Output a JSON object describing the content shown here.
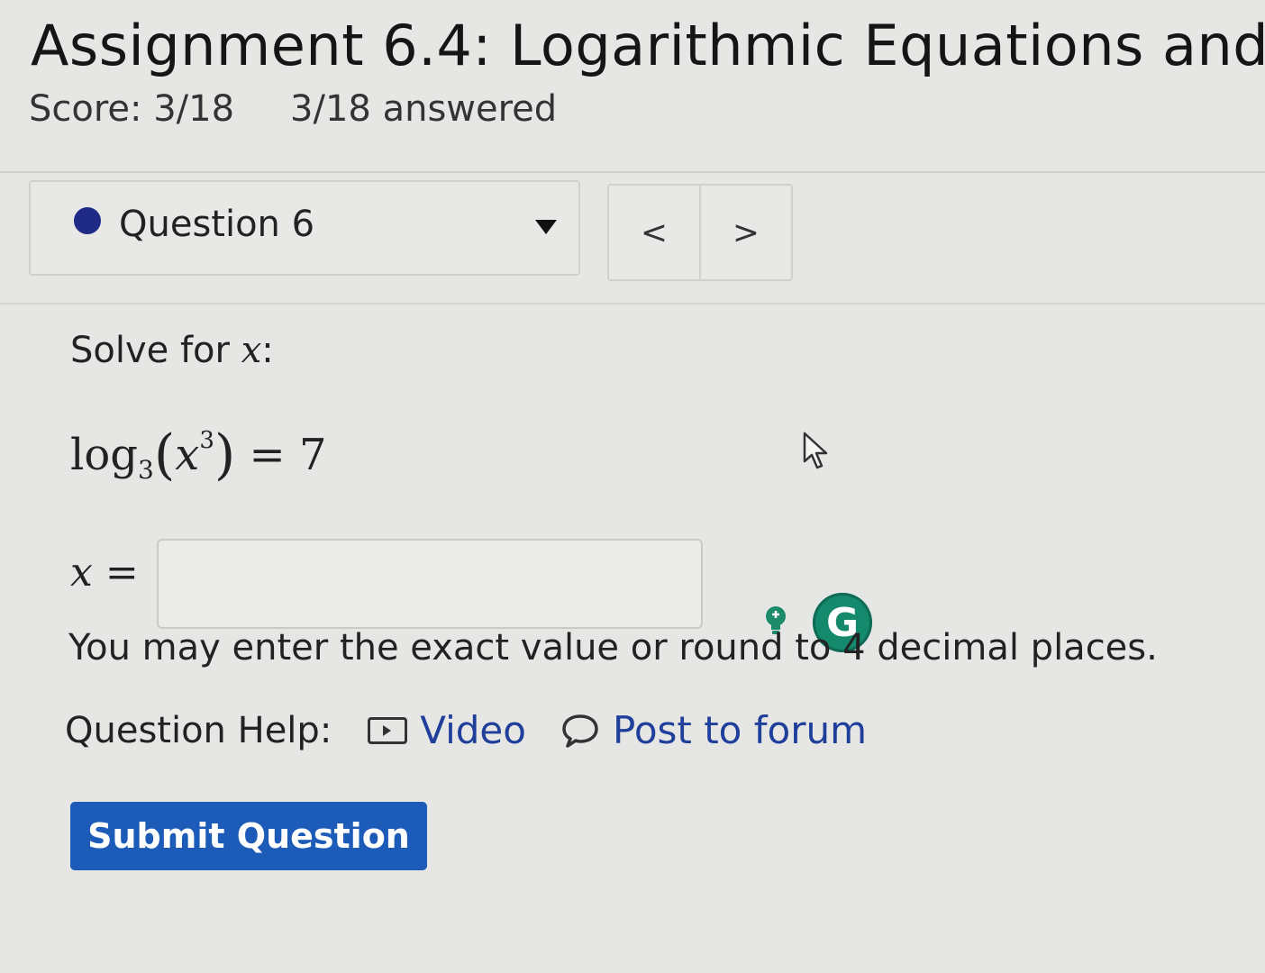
{
  "assignment": {
    "title": "Assignment 6.4: Logarithmic Equations and",
    "score": "Score: 3/18",
    "answered": "3/18 answered"
  },
  "question_nav": {
    "selected_question": "Question 6",
    "prev_label": "<",
    "next_label": ">"
  },
  "question": {
    "prompt_prefix": "Solve for",
    "prompt_var": "x",
    "prompt_suffix": ":",
    "equation": {
      "func": "log",
      "base": "3",
      "arg_var": "x",
      "exponent": "3",
      "equals": "=",
      "rhs": "7"
    },
    "answer_var": "x",
    "answer_equals": "=",
    "answer_value": "",
    "rounding_note": "You may enter the exact value or round to 4 decimal places."
  },
  "help": {
    "label": "Question Help:",
    "video_label": "Video",
    "forum_label": "Post to forum"
  },
  "submit_label": "Submit Question",
  "grammarly_letter": "G",
  "colors": {
    "accent": "#1d5bb8",
    "link": "#1f3f9a",
    "dot": "#1e2a86",
    "grammarly": "#15896c"
  }
}
